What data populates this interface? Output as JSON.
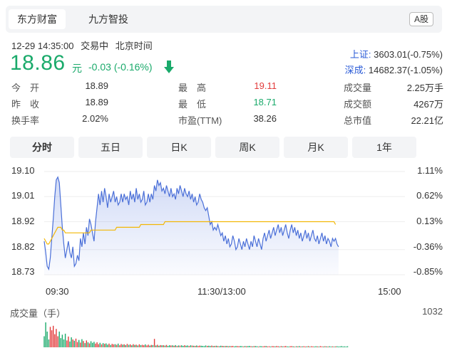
{
  "tabs": [
    {
      "label": "东方财富",
      "active": true
    },
    {
      "label": "九方智投",
      "active": false
    }
  ],
  "market_badge": "A股",
  "quote_meta": {
    "datetime": "12-29 14:35:00",
    "status": "交易中",
    "timezone": "北京时间"
  },
  "price": {
    "value": "18.86",
    "unit": "元",
    "change": "-0.03",
    "change_pct": "(-0.16%)",
    "direction": "down",
    "color": "#1aaa6b"
  },
  "indices": [
    {
      "name": "上证:",
      "value": "3603.01(-0.75%)"
    },
    {
      "name": "深成:",
      "value": "14682.37(-1.05%)"
    }
  ],
  "stats": {
    "col1": [
      {
        "label": "今　开",
        "value": "18.89"
      },
      {
        "label": "昨　收",
        "value": "18.89"
      },
      {
        "label": "换手率",
        "value": "2.02%"
      }
    ],
    "col2": [
      {
        "label": "最　高",
        "value": "19.11",
        "color": "red"
      },
      {
        "label": "最　低",
        "value": "18.71",
        "color": "green"
      },
      {
        "label": "市盈(TTM)",
        "value": "38.26"
      }
    ],
    "col3": [
      {
        "label": "成交量",
        "value": "2.25万手"
      },
      {
        "label": "成交额",
        "value": "4267万"
      },
      {
        "label": "总市值",
        "value": "22.21亿"
      }
    ]
  },
  "period_tabs": [
    {
      "label": "分时",
      "active": true
    },
    {
      "label": "五日",
      "active": false
    },
    {
      "label": "日K",
      "active": false
    },
    {
      "label": "周K",
      "active": false
    },
    {
      "label": "月K",
      "active": false
    },
    {
      "label": "1年",
      "active": false
    }
  ],
  "chart_data": {
    "type": "line",
    "y_ticks_left": [
      "19.10",
      "19.01",
      "18.92",
      "18.82",
      "18.73"
    ],
    "y_ticks_right": [
      "1.11%",
      "0.62%",
      "0.13%",
      "-0.36%",
      "-0.85%"
    ],
    "x_ticks": [
      "09:30",
      "11:30/13:00",
      "15:00"
    ],
    "ylim": [
      18.73,
      19.1
    ],
    "prev_close": 18.89,
    "series": [
      {
        "values": [
          18.85,
          18.81,
          18.76,
          18.75,
          18.79,
          18.86,
          18.93,
          19.01,
          19.07,
          19.08,
          19.06,
          18.98,
          18.9,
          18.84,
          18.79,
          18.82,
          18.85,
          18.81,
          18.79,
          18.83,
          18.76,
          18.77,
          18.8,
          18.78,
          18.86,
          18.83,
          18.88,
          18.84,
          18.9,
          18.87,
          18.93,
          18.91,
          18.88,
          18.85,
          18.92,
          18.97,
          19.02,
          18.98,
          19.03,
          18.99,
          19.04,
          19.01,
          18.97,
          19.02,
          18.99,
          19.01,
          19.03,
          18.99,
          19.01,
          18.98,
          18.99,
          19.02,
          18.99,
          19.02,
          19.0,
          19.01,
          18.98,
          19.03,
          19.0,
          19.02,
          18.99,
          19.04,
          19.0,
          19.02,
          18.99,
          19.0,
          19.03,
          18.98,
          18.99,
          19.02,
          18.99,
          19.02,
          19.0,
          19.05,
          19.03,
          19.07,
          19.05,
          19.06,
          19.03,
          19.04,
          19.02,
          19.05,
          19.03,
          19.01,
          19.04,
          19.01,
          19.02,
          19.0,
          19.04,
          19.02,
          19.05,
          19.03,
          19.01,
          19.04,
          19.02,
          19.01,
          19.03,
          19.0,
          19.02,
          18.99,
          19.01,
          18.98,
          18.99,
          19.02,
          19.0,
          18.99,
          18.97,
          18.96,
          18.97,
          18.94,
          18.91,
          18.92,
          18.89,
          18.9,
          18.89,
          18.91,
          18.89,
          18.87,
          18.88,
          18.85,
          18.87,
          18.84,
          18.86,
          18.83,
          18.84,
          18.87,
          18.85,
          18.82,
          18.83,
          18.86,
          18.84,
          18.82,
          18.85,
          18.83,
          18.86,
          18.84,
          18.82,
          18.85,
          18.83,
          18.87,
          18.85,
          18.83,
          18.86,
          18.84,
          18.82,
          18.86,
          18.88,
          18.85,
          18.87,
          18.89,
          18.86,
          18.88,
          18.9,
          18.87,
          18.89,
          18.91,
          18.88,
          18.9,
          18.87,
          18.89,
          18.91,
          18.88,
          18.86,
          18.89,
          18.91,
          18.88,
          18.9,
          18.87,
          18.89,
          18.86,
          18.88,
          18.85,
          18.87,
          18.89,
          18.86,
          18.88,
          18.85,
          18.87,
          18.89,
          18.86,
          18.85,
          18.87,
          18.84,
          18.86,
          18.88,
          18.85,
          18.87,
          18.84,
          18.86,
          18.85,
          18.83,
          18.86,
          18.85,
          18.86,
          18.84,
          18.83
        ],
        "color": "#4a6fd8"
      },
      {
        "values": [
          18.86,
          18.85,
          18.84,
          18.84,
          18.85,
          18.86,
          18.87,
          18.88,
          18.89,
          18.9,
          18.9,
          18.9,
          18.89,
          18.89,
          18.88,
          18.88,
          18.88,
          18.88,
          18.88,
          18.88,
          18.88,
          18.88,
          18.88,
          18.88,
          18.88,
          18.88,
          18.88,
          18.88,
          18.88,
          18.88,
          18.88,
          18.89,
          18.89,
          18.89,
          18.89,
          18.89,
          18.89,
          18.89,
          18.89,
          18.89,
          18.89,
          18.89,
          18.89,
          18.89,
          18.89,
          18.89,
          18.89,
          18.89,
          18.9,
          18.9,
          18.9,
          18.9,
          18.9,
          18.9,
          18.9,
          18.9,
          18.9,
          18.9,
          18.9,
          18.9,
          18.9,
          18.9,
          18.9,
          18.9,
          18.91,
          18.91,
          18.91,
          18.91,
          18.91,
          18.91,
          18.91,
          18.91,
          18.91,
          18.91,
          18.91,
          18.91,
          18.91,
          18.91,
          18.91,
          18.91,
          18.92,
          18.92,
          18.92,
          18.92,
          18.92,
          18.92,
          18.92,
          18.92,
          18.92,
          18.92,
          18.92,
          18.92,
          18.92,
          18.92,
          18.92,
          18.92,
          18.92,
          18.92,
          18.92,
          18.92,
          18.92,
          18.92,
          18.92,
          18.92,
          18.92,
          18.92,
          18.92,
          18.92,
          18.92,
          18.92,
          18.92,
          18.92,
          18.92,
          18.92,
          18.92,
          18.92,
          18.92,
          18.92,
          18.92,
          18.92,
          18.92,
          18.92,
          18.92,
          18.92,
          18.92,
          18.92,
          18.92,
          18.92,
          18.92,
          18.92,
          18.92,
          18.92,
          18.92,
          18.92,
          18.92,
          18.92,
          18.92,
          18.92,
          18.92,
          18.92,
          18.92,
          18.92,
          18.92,
          18.92,
          18.92,
          18.92,
          18.92,
          18.92,
          18.92,
          18.92,
          18.92,
          18.92,
          18.92,
          18.92,
          18.92,
          18.92,
          18.92,
          18.92,
          18.92,
          18.92,
          18.92,
          18.92,
          18.92,
          18.92,
          18.92,
          18.92,
          18.92,
          18.92,
          18.92,
          18.92,
          18.92,
          18.92,
          18.92,
          18.92,
          18.92,
          18.92,
          18.92,
          18.92,
          18.92,
          18.92,
          18.92,
          18.92,
          18.92,
          18.92,
          18.92,
          18.92,
          18.92,
          18.92,
          18.92,
          18.92,
          18.92,
          18.92,
          18.92,
          18.91
        ],
        "color": "#f2b705"
      }
    ],
    "volume": {
      "title": "成交量（手）",
      "max_label": "1032",
      "max": 1032,
      "values": [
        420,
        950,
        600,
        300,
        780,
        650,
        820,
        500,
        700,
        420,
        600,
        350,
        480,
        300,
        520,
        260,
        410,
        220,
        380,
        300,
        250,
        330,
        200,
        280,
        180,
        310,
        240,
        160,
        260,
        190,
        150,
        230,
        170,
        210,
        140,
        190,
        120,
        170,
        110,
        160,
        130,
        150,
        100,
        140,
        90,
        130,
        110,
        120,
        95,
        140,
        80,
        125,
        100,
        115,
        85,
        130,
        95,
        110,
        75,
        120,
        90,
        100,
        70,
        115,
        85,
        95,
        80,
        110,
        70,
        100,
        65,
        90,
        85,
        320,
        70,
        95,
        60,
        85,
        75,
        80,
        65,
        90,
        55,
        80,
        70,
        75,
        60,
        85,
        50,
        70,
        65,
        75,
        55,
        80,
        60,
        70,
        50,
        75,
        65,
        60,
        55,
        70,
        50,
        65,
        60,
        55,
        45,
        70,
        55,
        60,
        50,
        65,
        45,
        55,
        60,
        50,
        40,
        60,
        55,
        45,
        50,
        55,
        40,
        50,
        45,
        55,
        35,
        50,
        45,
        40,
        50,
        45,
        35,
        50,
        40,
        45,
        55,
        40,
        35,
        45,
        50,
        40,
        30,
        45,
        40,
        35,
        45,
        50,
        35,
        40,
        30,
        45,
        40,
        35,
        50,
        40,
        30,
        45,
        35,
        40,
        50,
        35,
        30,
        40,
        45,
        35,
        30,
        40,
        35,
        45,
        30,
        35,
        40,
        30,
        35,
        45,
        30,
        40,
        35,
        30,
        40,
        35,
        30,
        45,
        35,
        30,
        40,
        35,
        30,
        40,
        30,
        35,
        30,
        35,
        40,
        30,
        35,
        45,
        30,
        35,
        30,
        40
      ],
      "up_color": "#e23b3b",
      "down_color": "#1aaa6b"
    }
  }
}
